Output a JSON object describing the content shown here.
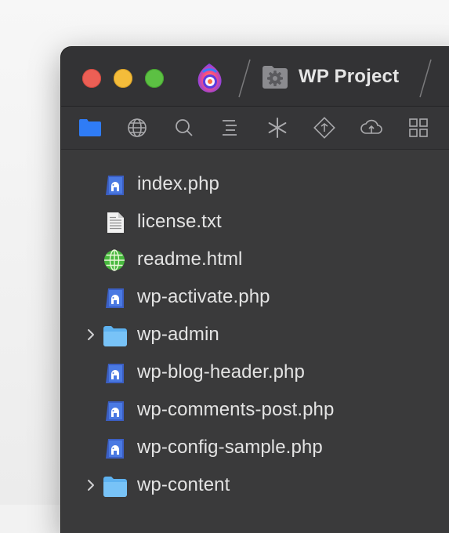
{
  "window": {
    "project_title": "WP Project"
  },
  "titlebar": {
    "traffic_lights": [
      "close",
      "minimize",
      "zoom"
    ],
    "app_icon": "app-logo-icon",
    "project_icon": "gear-folder-icon"
  },
  "toolbar": {
    "buttons": [
      {
        "icon": "files-icon",
        "active": true
      },
      {
        "icon": "globe-icon",
        "active": false
      },
      {
        "icon": "search-icon",
        "active": false
      },
      {
        "icon": "outline-icon",
        "active": false
      },
      {
        "icon": "asterisk-icon",
        "active": false
      },
      {
        "icon": "git-icon",
        "active": false
      },
      {
        "icon": "cloud-upload-icon",
        "active": false
      },
      {
        "icon": "grid-icon",
        "active": false
      }
    ],
    "active_color": "#2f7cf6"
  },
  "files": [
    {
      "name": "index.php",
      "type": "php",
      "expandable": false
    },
    {
      "name": "license.txt",
      "type": "text",
      "expandable": false
    },
    {
      "name": "readme.html",
      "type": "html",
      "expandable": false
    },
    {
      "name": "wp-activate.php",
      "type": "php",
      "expandable": false
    },
    {
      "name": "wp-admin",
      "type": "folder",
      "expandable": true
    },
    {
      "name": "wp-blog-header.php",
      "type": "php",
      "expandable": false
    },
    {
      "name": "wp-comments-post.php",
      "type": "php",
      "expandable": false
    },
    {
      "name": "wp-config-sample.php",
      "type": "php",
      "expandable": false
    },
    {
      "name": "wp-content",
      "type": "folder",
      "expandable": true
    }
  ]
}
